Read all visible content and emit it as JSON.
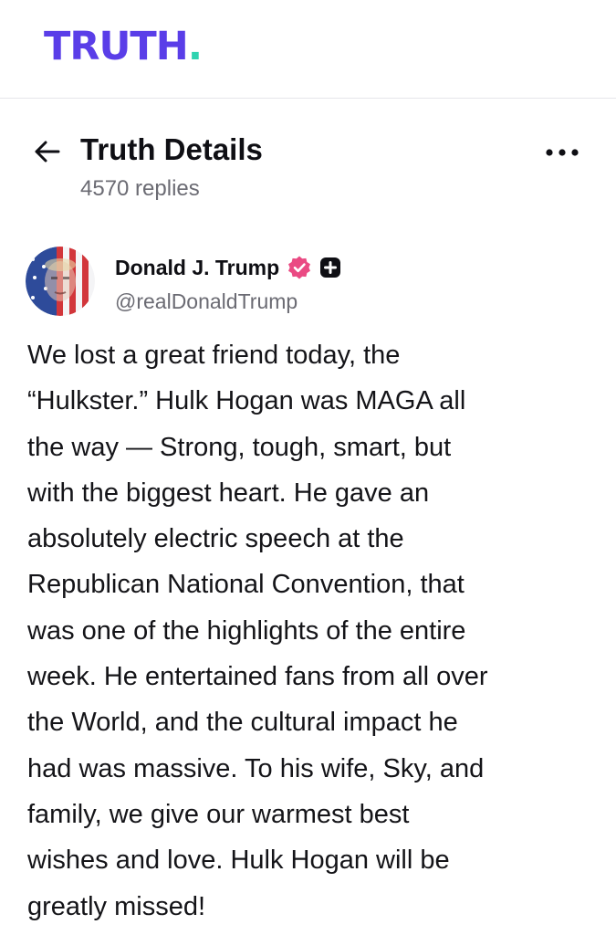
{
  "app": {
    "logo_text": "TRUTH",
    "logo_dot": ".",
    "brand_color": "#5a3ee8",
    "accent_color": "#2fd3b0"
  },
  "details": {
    "title": "Truth Details",
    "replies": "4570 replies",
    "back_icon": "arrow-left-icon",
    "more_icon": "more-horizontal-icon"
  },
  "author": {
    "name": "Donald J. Trump",
    "handle": "@realDonaldTrump",
    "verified_icon": "verified-badge-icon",
    "verified_color": "#ea4a83",
    "plus_icon": "plus-badge-icon"
  },
  "post": {
    "lines": [
      "We lost a great friend today, the",
      "“Hulkster.” Hulk Hogan was MAGA all",
      "the way — Strong, tough, smart, but",
      "with the biggest heart. He gave an",
      "absolutely electric speech at the",
      "Republican National Convention, that",
      "was one of the highlights of the entire",
      "week. He entertained fans from all over",
      "the World, and the cultural impact he",
      "had was massive. To his wife, Sky, and",
      "family, we give our warmest best",
      "wishes and love. Hulk Hogan will be",
      "greatly missed!"
    ]
  }
}
